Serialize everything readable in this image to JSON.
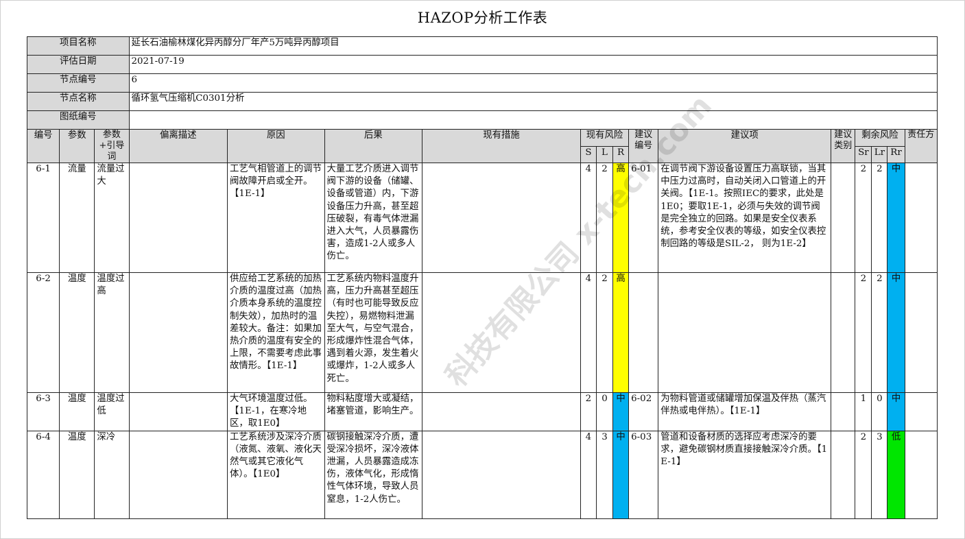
{
  "title": "HAZOP分析工作表",
  "info": {
    "project_label": "项目名称",
    "project_value": "延长石油榆林煤化异丙醇分厂年产5万吨异丙醇项目",
    "date_label": "评估日期",
    "date_value": "2021-07-19",
    "node_no_label": "节点编号",
    "node_no_value": "6",
    "node_name_label": "节点名称",
    "node_name_value": "循环氢气压缩机C0301分析",
    "drawing_label": "图纸编号",
    "drawing_value": ""
  },
  "headers": {
    "no": "编号",
    "param": "参数",
    "guide": "参数+引导词",
    "deviation": "偏离描述",
    "cause": "原因",
    "consequence": "后果",
    "safeguards": "现有措施",
    "risk": "现有风险",
    "s": "S",
    "l": "L",
    "r": "R",
    "rec_no": "建议编号",
    "recommendation": "建议项",
    "rec_type": "建议类别",
    "residual": "剩余风险",
    "sr": "Sr",
    "lr": "Lr",
    "rr": "Rr",
    "owner": "责任方"
  },
  "rows": [
    {
      "no": "6-1",
      "param": "流量",
      "guide": "流量过大",
      "deviation": "",
      "cause": "工艺气相管道上的调节阀故障开启或全开。【1E-1】",
      "consequence": "大量工艺介质进入调节阀下游的设备（储罐、设备或管道）内，下游设备压力升高，甚至超压破裂，有毒气体泄漏进入大气，人员暴露伤害，造成1-2人或多人伤亡。",
      "safeguards": "",
      "s": "4",
      "l": "2",
      "r": "高",
      "rec_no": "6-01",
      "recommendation": "在调节阀下游设备设置压力高联锁，当其中压力过高时，自动关闭入口管道上的开关阀。【1E-1。按照IEC的要求，此处是1E0；要取1E-1，必须与失效的调节阀是完全独立的回路。如果是安全仪表系统，参考安全仪表的等级，如安全仪表控制回路的等级是SIL-2， 则为1E-2】",
      "rec_type": "",
      "sr": "2",
      "lr": "2",
      "rr": "中",
      "owner": ""
    },
    {
      "no": "6-2",
      "param": "温度",
      "guide": "温度过高",
      "deviation": "",
      "cause": "供应给工艺系统的加热介质的温度过高（加热介质本身系统的温度控制失效），加热时的温差较大。备注：如果加热介质的温度有安全的上限，不需要考虑此事故情形。【1E-1】",
      "consequence": "工艺系统内物料温度升高，压力升高甚至超压（有时也可能导致反应失控），易燃物料泄漏至大气，与空气混合，形成爆炸性混合气体，遇到着火源，发生着火或爆炸，1-2人或多人死亡。",
      "safeguards": "",
      "s": "4",
      "l": "2",
      "r": "高",
      "rec_no": "",
      "recommendation": "",
      "rec_type": "",
      "sr": "2",
      "lr": "2",
      "rr": "中",
      "owner": ""
    },
    {
      "no": "6-3",
      "param": "温度",
      "guide": "温度过低",
      "deviation": "",
      "cause": "大气环境温度过低。【1E-1，在寒冷地区，取1E0】",
      "consequence": "物料粘度增大或凝结，堵塞管道，影响生产。",
      "safeguards": "",
      "s": "2",
      "l": "0",
      "r": "中",
      "rec_no": "6-02",
      "recommendation": "为物料管道或储罐增加保温及伴热（蒸汽伴热或电伴热）。【1E-1】",
      "rec_type": "",
      "sr": "1",
      "lr": "0",
      "rr": "中",
      "owner": ""
    },
    {
      "no": "6-4",
      "param": "温度",
      "guide": "深冷",
      "deviation": "",
      "cause": "工艺系统涉及深冷介质（液氮、液氧、液化天然气或其它液化气体）。【1E0】",
      "consequence": "碳钢接触深冷介质，遭受深冷损坏，深冷液体泄漏，人员暴露造成冻伤，液体气化，形成惰性气体环境，导致人员窒息，1-2人伤亡。",
      "safeguards": "",
      "s": "4",
      "l": "3",
      "r": "中",
      "rec_no": "6-03",
      "recommendation": "管道和设备材质的选择应考虑深冷的要求，避免碳钢材质直接接触深冷介质。【1E-1】",
      "rec_type": "",
      "sr": "2",
      "lr": "3",
      "rr": "低",
      "owner": ""
    }
  ],
  "watermark": "科技有限公司 x-tech.com",
  "colors": {
    "high": "#ffff00",
    "medium": "#00b0f0",
    "low": "#00e600",
    "header_bg": "#d9d9d9"
  }
}
